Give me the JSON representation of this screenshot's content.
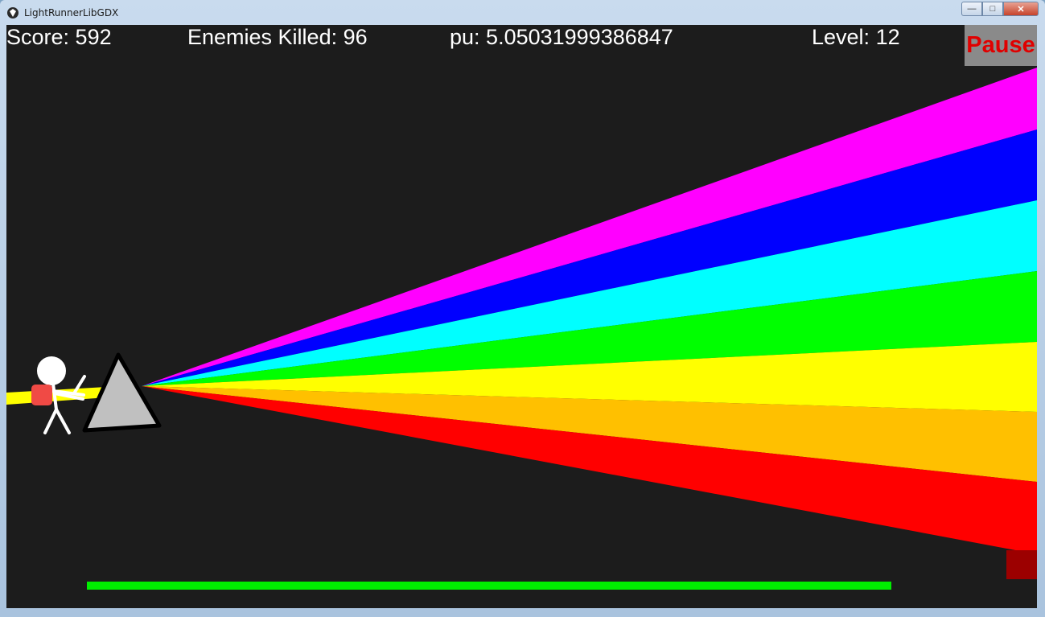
{
  "window": {
    "title": "LightRunnerLibGDX",
    "minimize_icon": "minimize-icon",
    "maximize_icon": "maximize-icon",
    "close_icon": "close-icon"
  },
  "hud": {
    "score_label": "Score: ",
    "score_value": "592",
    "enemies_label": "Enemies Killed: ",
    "enemies_value": "96",
    "pu_label": "pu: ",
    "pu_value": "5.05031999386847",
    "level_label": "Level: ",
    "level_value": "12",
    "pause_label": "Pause"
  },
  "power_bar": {
    "fill_fraction": 1.0,
    "color": "#00ee00"
  },
  "colors": {
    "background": "#1c1c1c",
    "beam_colors": [
      "#ff00ff",
      "#0000ff",
      "#00ffff",
      "#00ff00",
      "#ffff00",
      "#ffc000",
      "#ff0000"
    ],
    "incoming_beam": "#ffff00",
    "prism_fill": "#c0c0c0",
    "pause_text": "#e00000",
    "enemy": "#9c0000"
  }
}
